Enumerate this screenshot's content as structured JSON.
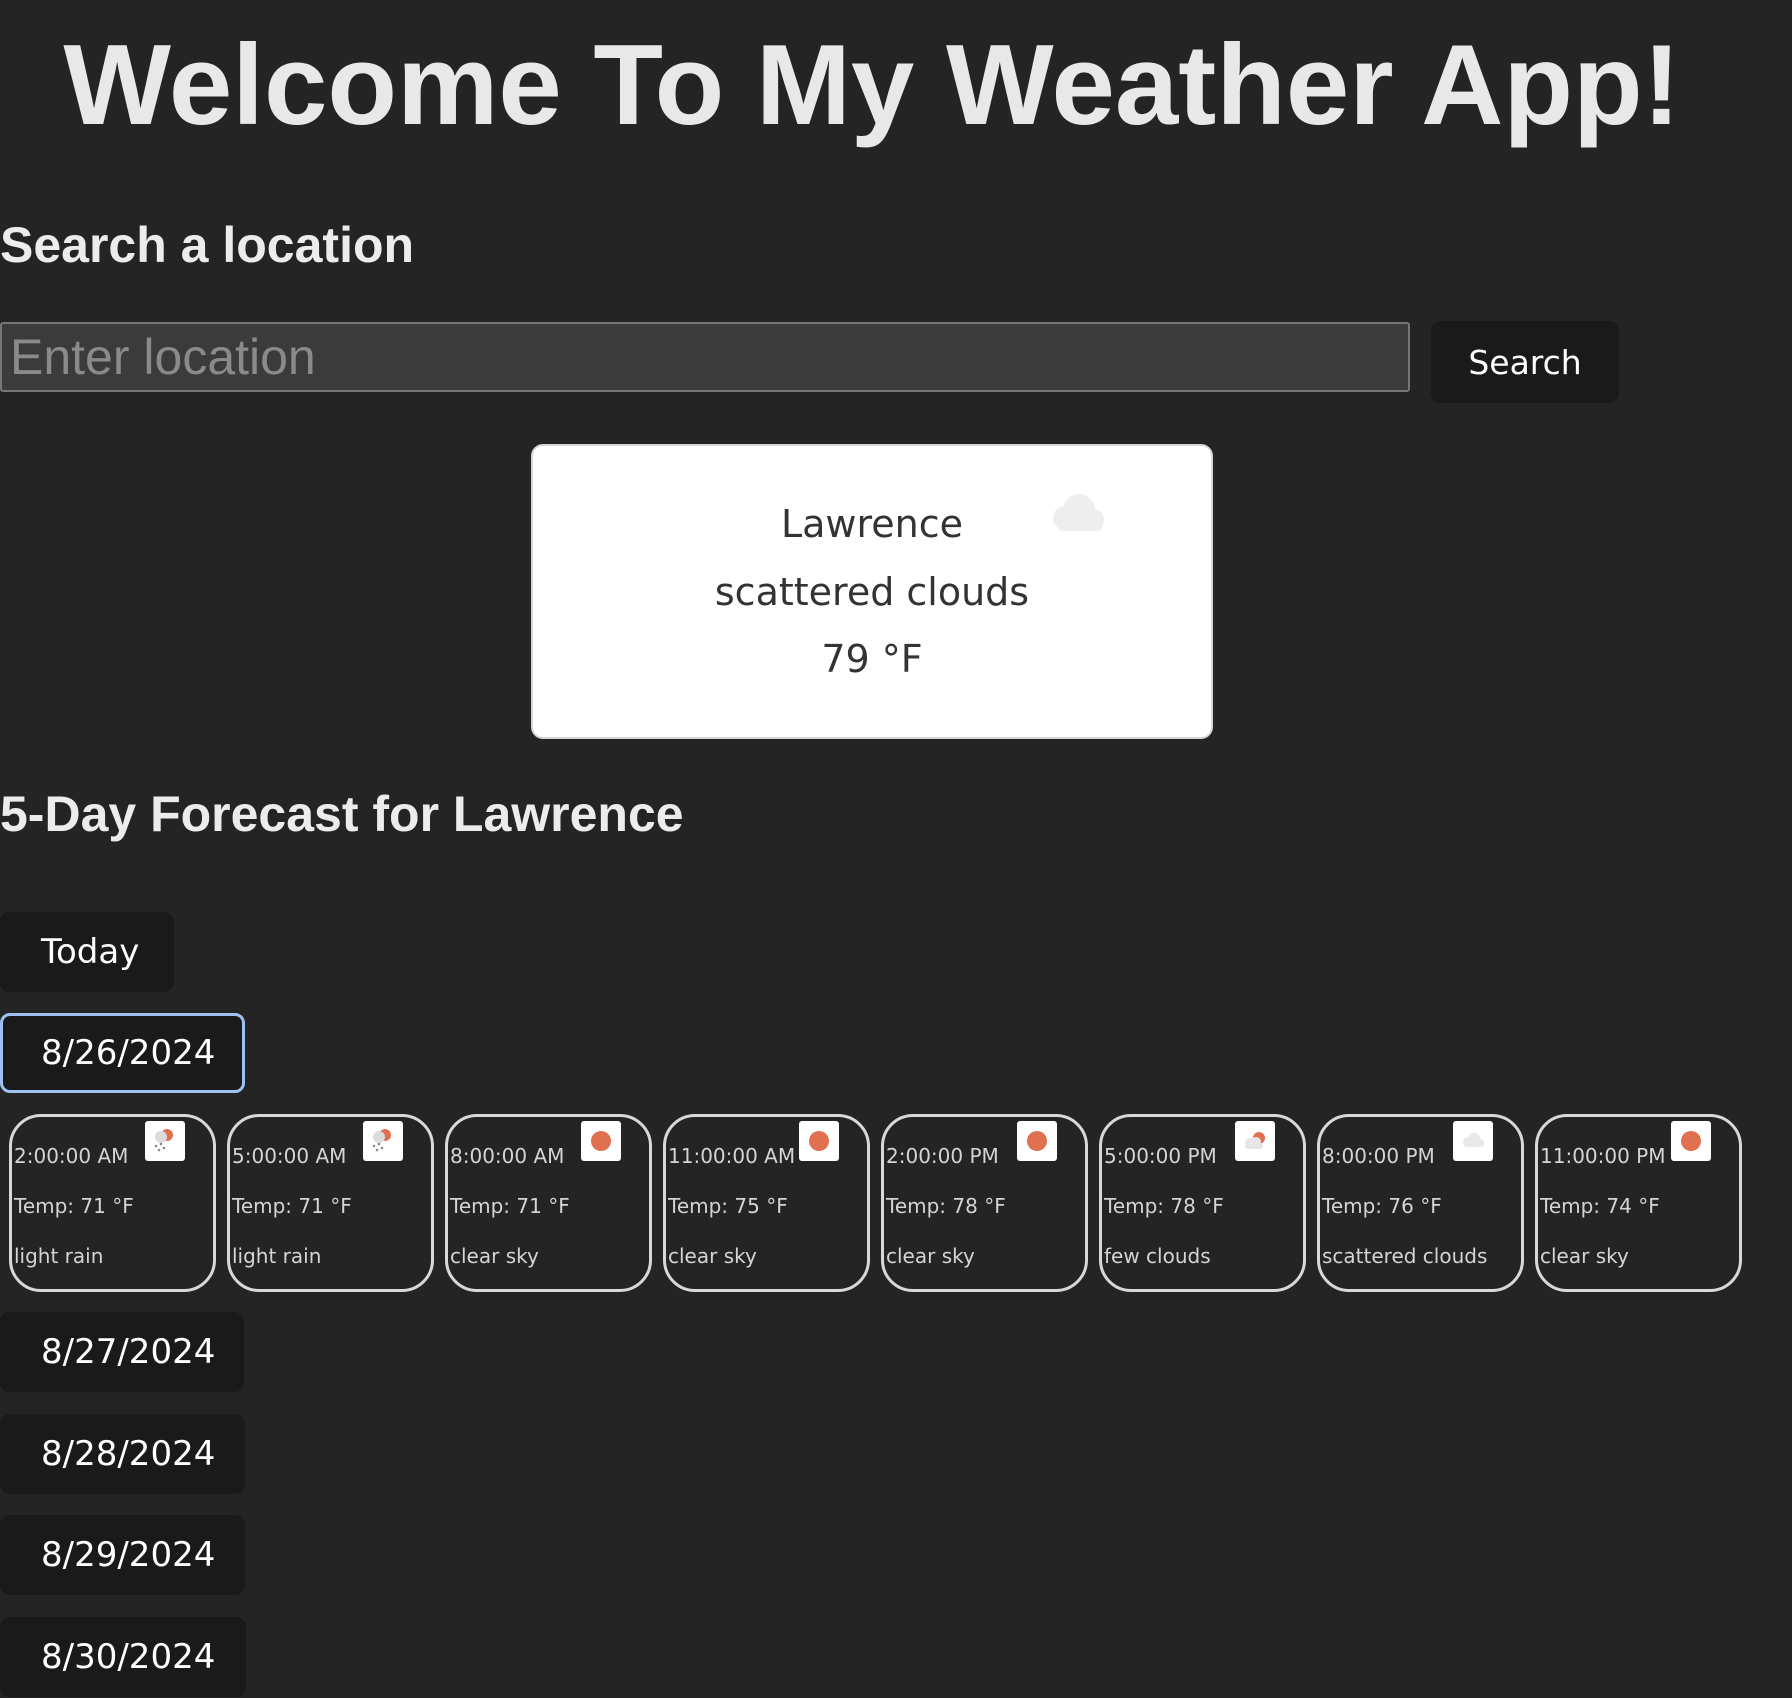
{
  "header": {
    "title": "Welcome To My Weather App!"
  },
  "search": {
    "heading": "Search a location",
    "placeholder": "Enter location",
    "value": "",
    "button_label": "Search"
  },
  "current": {
    "city": "Lawrence",
    "description": "scattered clouds",
    "temperature": "79 °F",
    "icon": "cloud-icon"
  },
  "forecast": {
    "heading": "5-Day Forecast for Lawrence",
    "today_label": "Today",
    "days": [
      {
        "label": "8/26/2024",
        "selected": true
      },
      {
        "label": "8/27/2024",
        "selected": false
      },
      {
        "label": "8/28/2024",
        "selected": false
      },
      {
        "label": "8/29/2024",
        "selected": false
      },
      {
        "label": "8/30/2024",
        "selected": false
      }
    ],
    "hours": [
      {
        "time": "2:00:00 AM",
        "temp": "Temp: 71 °F",
        "desc": "light rain",
        "icon": "rain-icon"
      },
      {
        "time": "5:00:00 AM",
        "temp": "Temp: 71 °F",
        "desc": "light rain",
        "icon": "rain-icon"
      },
      {
        "time": "8:00:00 AM",
        "temp": "Temp: 71 °F",
        "desc": "clear sky",
        "icon": "sun-icon"
      },
      {
        "time": "11:00:00 AM",
        "temp": "Temp: 75 °F",
        "desc": "clear sky",
        "icon": "sun-icon"
      },
      {
        "time": "2:00:00 PM",
        "temp": "Temp: 78 °F",
        "desc": "clear sky",
        "icon": "sun-icon"
      },
      {
        "time": "5:00:00 PM",
        "temp": "Temp: 78 °F",
        "desc": "few clouds",
        "icon": "few-clouds-icon"
      },
      {
        "time": "8:00:00 PM",
        "temp": "Temp: 76 °F",
        "desc": "scattered clouds",
        "icon": "cloud-icon"
      },
      {
        "time": "11:00:00 PM",
        "temp": "Temp: 74 °F",
        "desc": "clear sky",
        "icon": "sun-icon"
      }
    ]
  },
  "colors": {
    "background": "#242424",
    "button": "#1a1a1a",
    "selected_border": "#9fc0f2",
    "sun": "#e07050",
    "card": "#ffffff"
  }
}
